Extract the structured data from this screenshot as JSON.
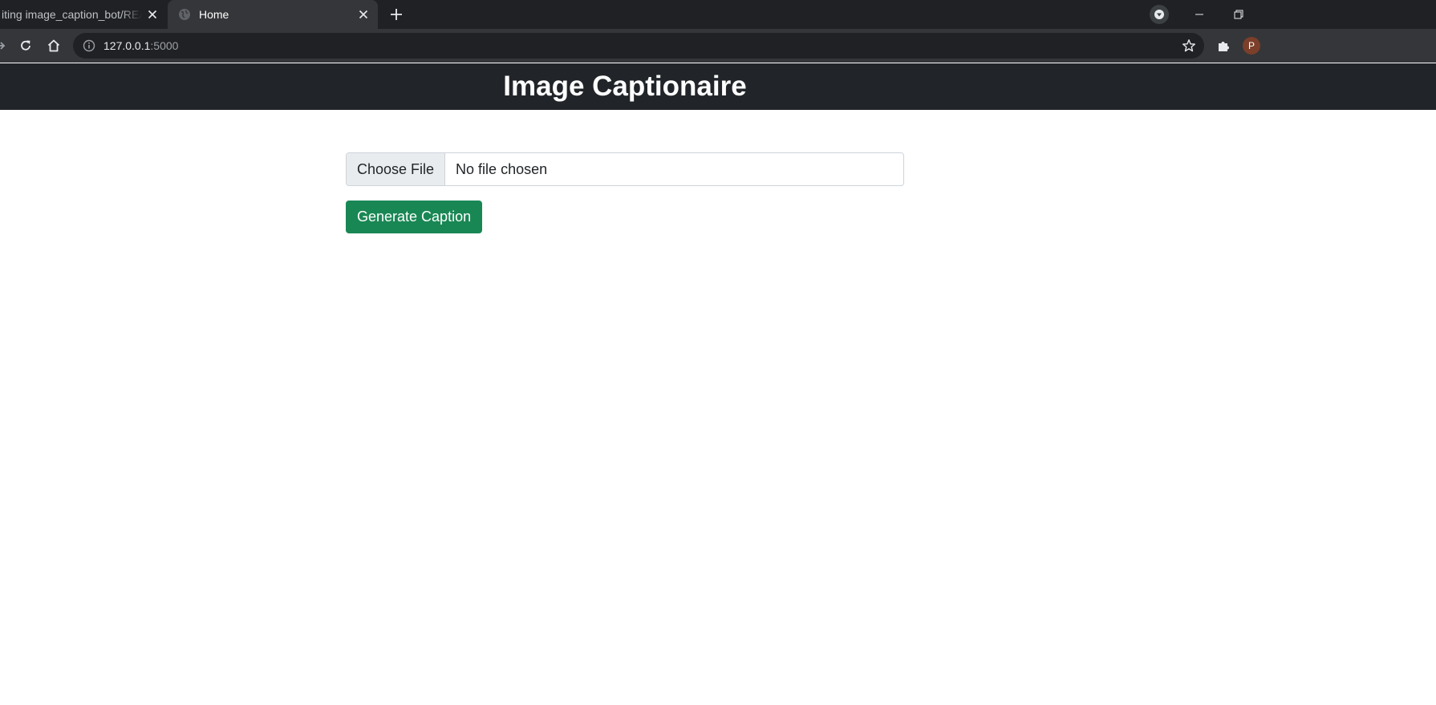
{
  "browser": {
    "tabs": [
      {
        "title": "iting image_caption_bot/READ",
        "active": false
      },
      {
        "title": "Home",
        "active": true
      }
    ],
    "url_host": "127.0.0.1",
    "url_port": ":5000",
    "profile_initial": "P"
  },
  "page": {
    "brand": "Image Captionaire",
    "file_input": {
      "button_label": "Choose File",
      "status": "No file chosen"
    },
    "generate_button": "Generate Caption"
  },
  "colors": {
    "navbar": "#212529",
    "button_success": "#198754"
  },
  "icons": [
    "globe-icon",
    "close-icon",
    "plus-icon",
    "tab-search-icon",
    "minimize-icon",
    "restore-icon",
    "reload-icon",
    "home-icon",
    "info-icon",
    "bookmark-star-icon",
    "extensions-icon"
  ]
}
